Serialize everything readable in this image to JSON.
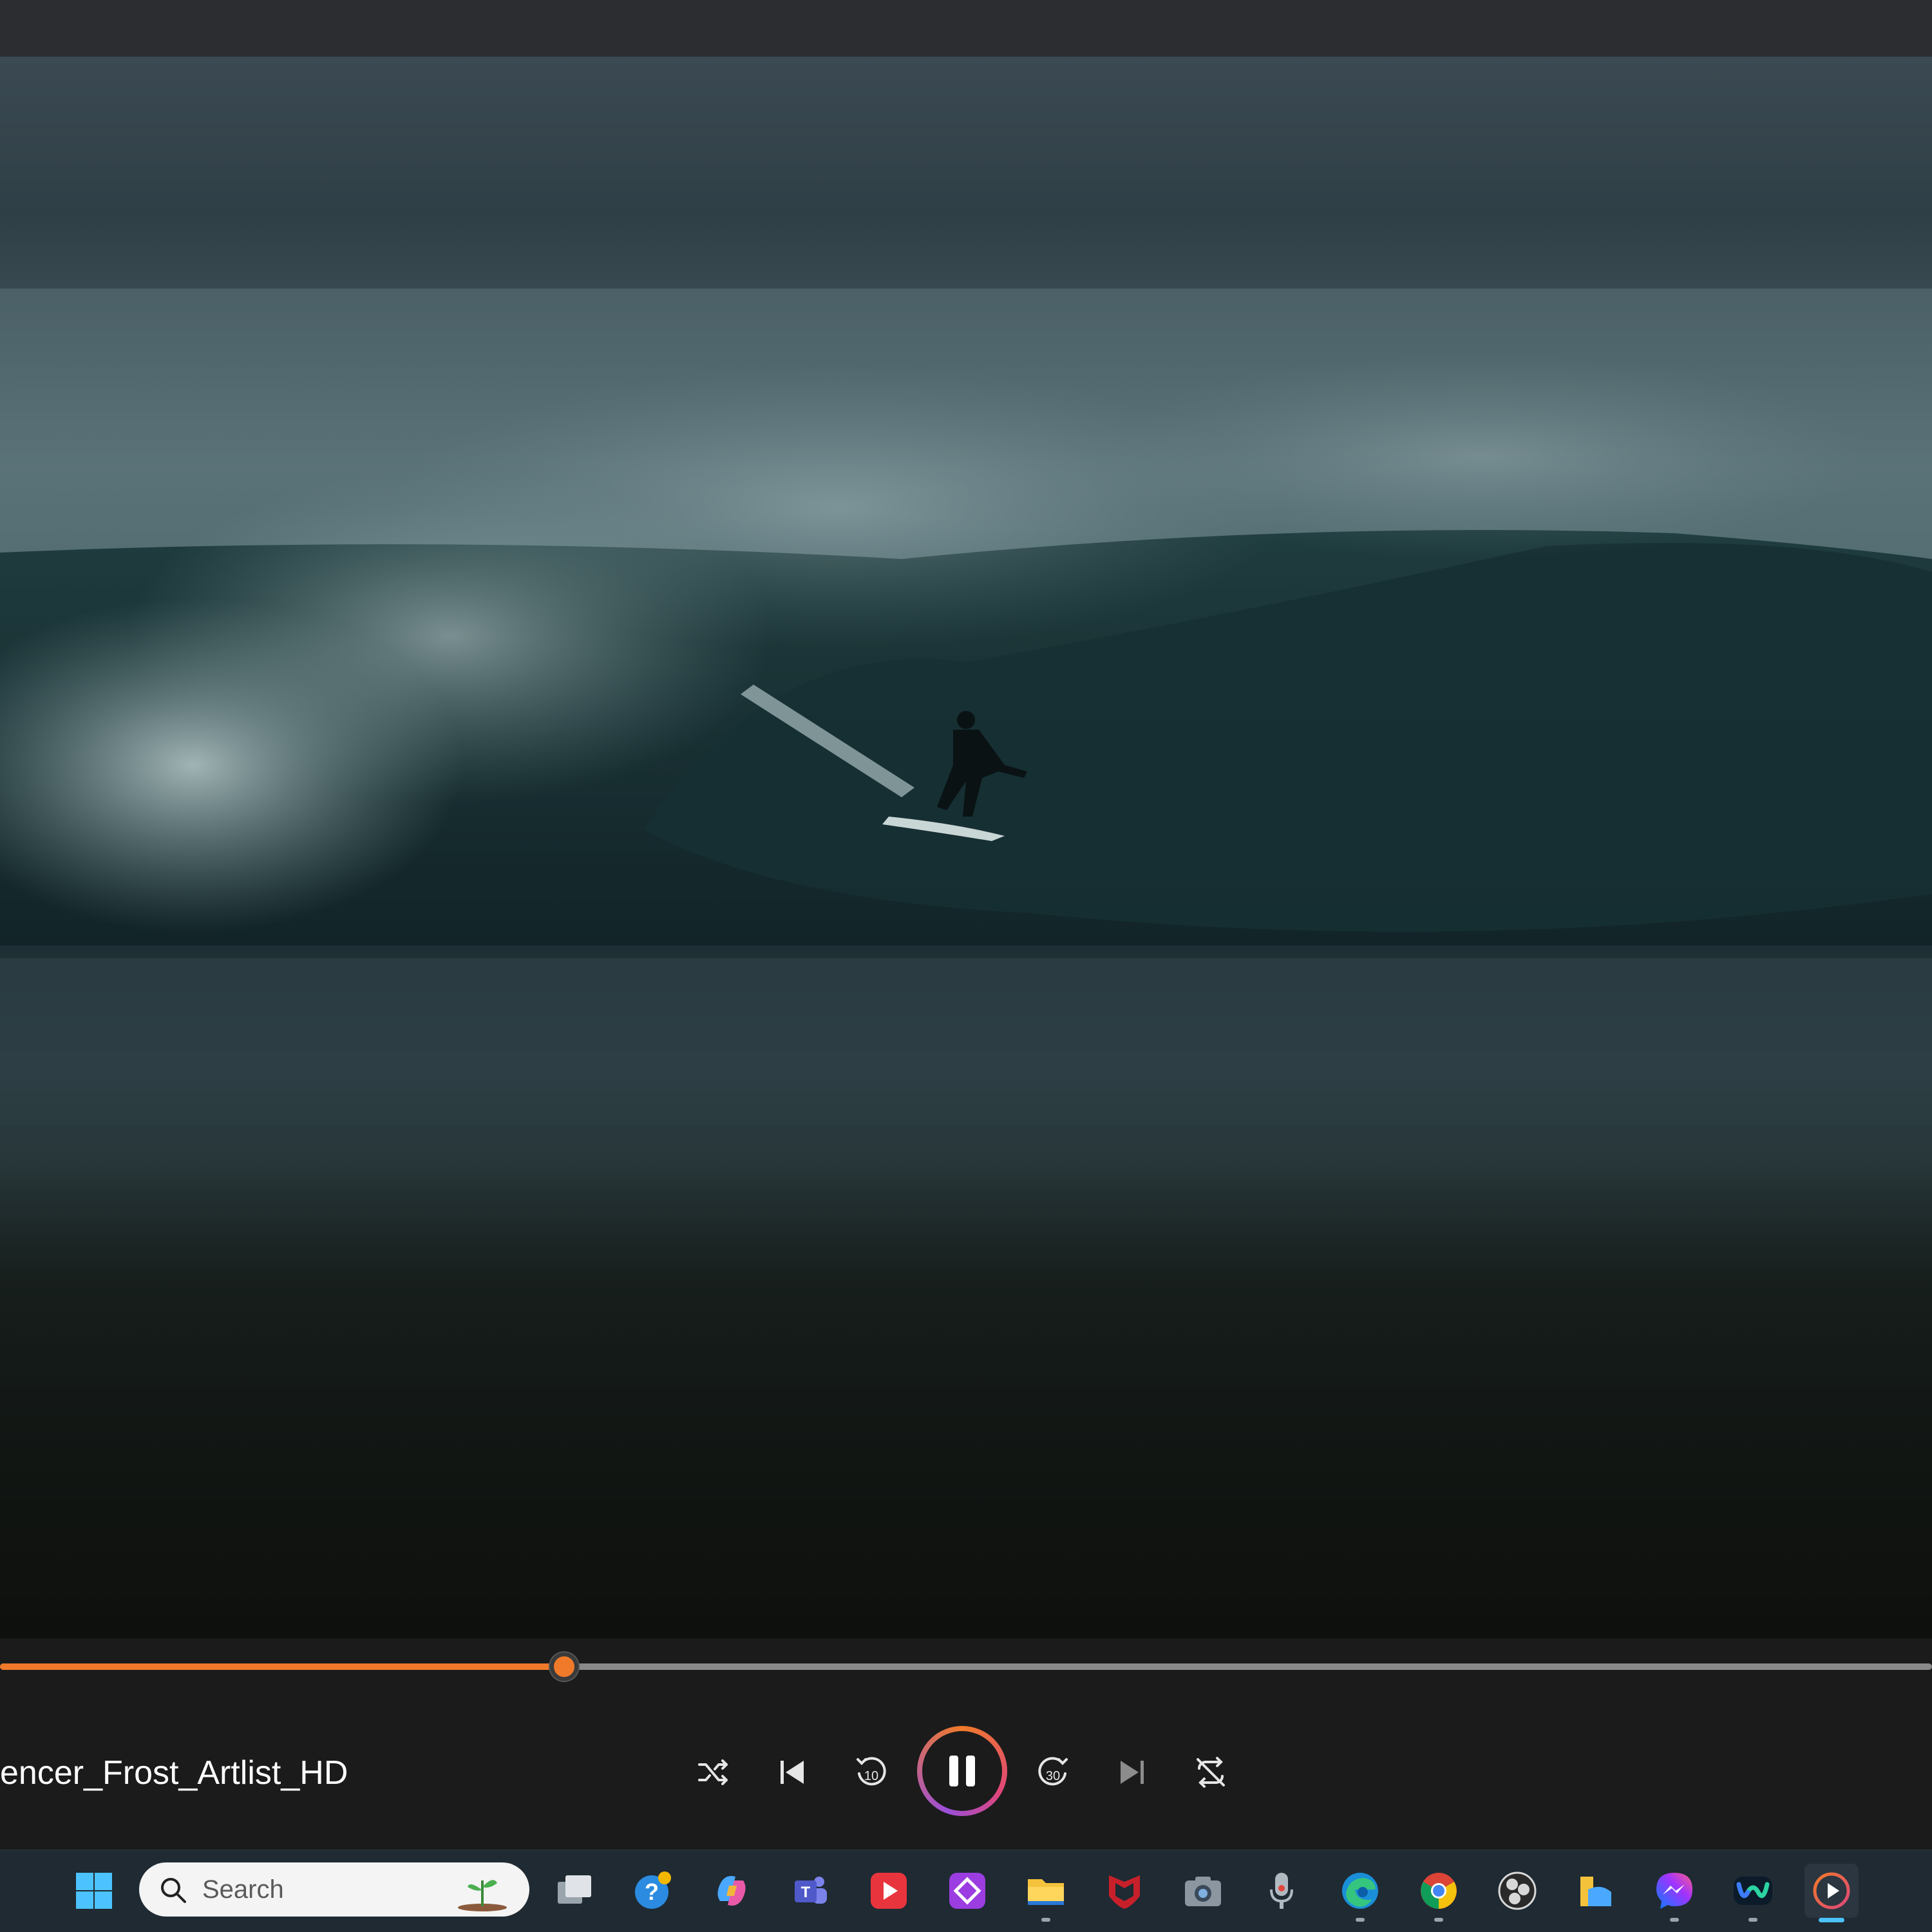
{
  "player": {
    "track_title": "encer_Frost_Artlist_HD",
    "progress_fraction": 0.292
  },
  "controls": {
    "shuffle_icon": "shuffle-icon",
    "previous_icon": "previous-icon",
    "rewind_label": "10",
    "forward_label": "30",
    "next_icon": "next-icon",
    "repeat_icon": "repeat-off-icon",
    "play_state": "playing"
  },
  "taskbar": {
    "search_placeholder": "Search",
    "apps": [
      "start",
      "task-view",
      "get-help",
      "copilot",
      "teams",
      "media-player-red",
      "purple-app",
      "file-explorer",
      "mcafee",
      "camera",
      "voice-recorder",
      "edge",
      "chrome",
      "obs",
      "files-alt",
      "messenger",
      "webex",
      "media-player"
    ]
  },
  "colors": {
    "accent": "#f07a2a",
    "taskbar_bg": "#1f2a33",
    "controls_bg": "#1b1b1b"
  }
}
